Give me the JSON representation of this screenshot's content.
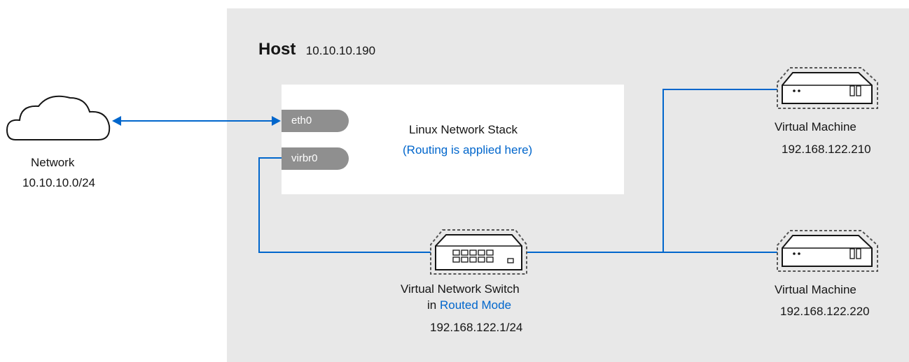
{
  "host": {
    "title": "Host",
    "ip": "10.10.10.190"
  },
  "network": {
    "label": "Network",
    "subnet": "10.10.10.0/24"
  },
  "stack": {
    "title": "Linux Network Stack",
    "note": "(Routing is applied here)"
  },
  "interfaces": {
    "eth0": "eth0",
    "virbr0": "virbr0"
  },
  "switch": {
    "line1": "Virtual Network Switch",
    "line2_prefix": "in ",
    "line2_mode": "Routed Mode",
    "ip": "192.168.122.1/24"
  },
  "vm1": {
    "label": "Virtual Machine",
    "ip": "192.168.122.210"
  },
  "vm2": {
    "label": "Virtual Machine",
    "ip": "192.168.122.220"
  },
  "colors": {
    "link": "#0066cc",
    "host_bg": "#e8e8e8",
    "iface": "#8f8f8f",
    "icon_stroke": "#151515"
  }
}
